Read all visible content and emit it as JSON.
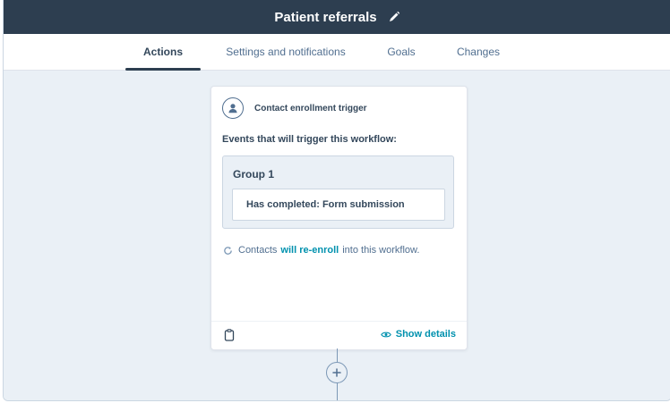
{
  "workflow": {
    "title": "Patient referrals"
  },
  "tabs": [
    {
      "label": "Actions",
      "active": true
    },
    {
      "label": "Settings and notifications",
      "active": false
    },
    {
      "label": "Goals",
      "active": false
    },
    {
      "label": "Changes",
      "active": false
    }
  ],
  "trigger_card": {
    "heading": "Contact enrollment trigger",
    "events_label": "Events that will trigger this workflow:",
    "group": {
      "title": "Group 1",
      "condition": "Has completed: Form submission"
    },
    "reenroll": {
      "prefix": "Contacts",
      "link": "will re-enroll",
      "suffix": "into this workflow."
    },
    "footer": {
      "show_details": "Show details"
    }
  },
  "icons": {
    "edit": "pencil-icon",
    "contact": "contact-icon",
    "reenroll": "refresh-icon",
    "clipboard": "clipboard-icon",
    "view": "eye-icon",
    "add_action": "plus-icon"
  },
  "colors": {
    "header": "#2d3e50",
    "link": "#0091ae",
    "canvas": "#eaf0f6"
  }
}
